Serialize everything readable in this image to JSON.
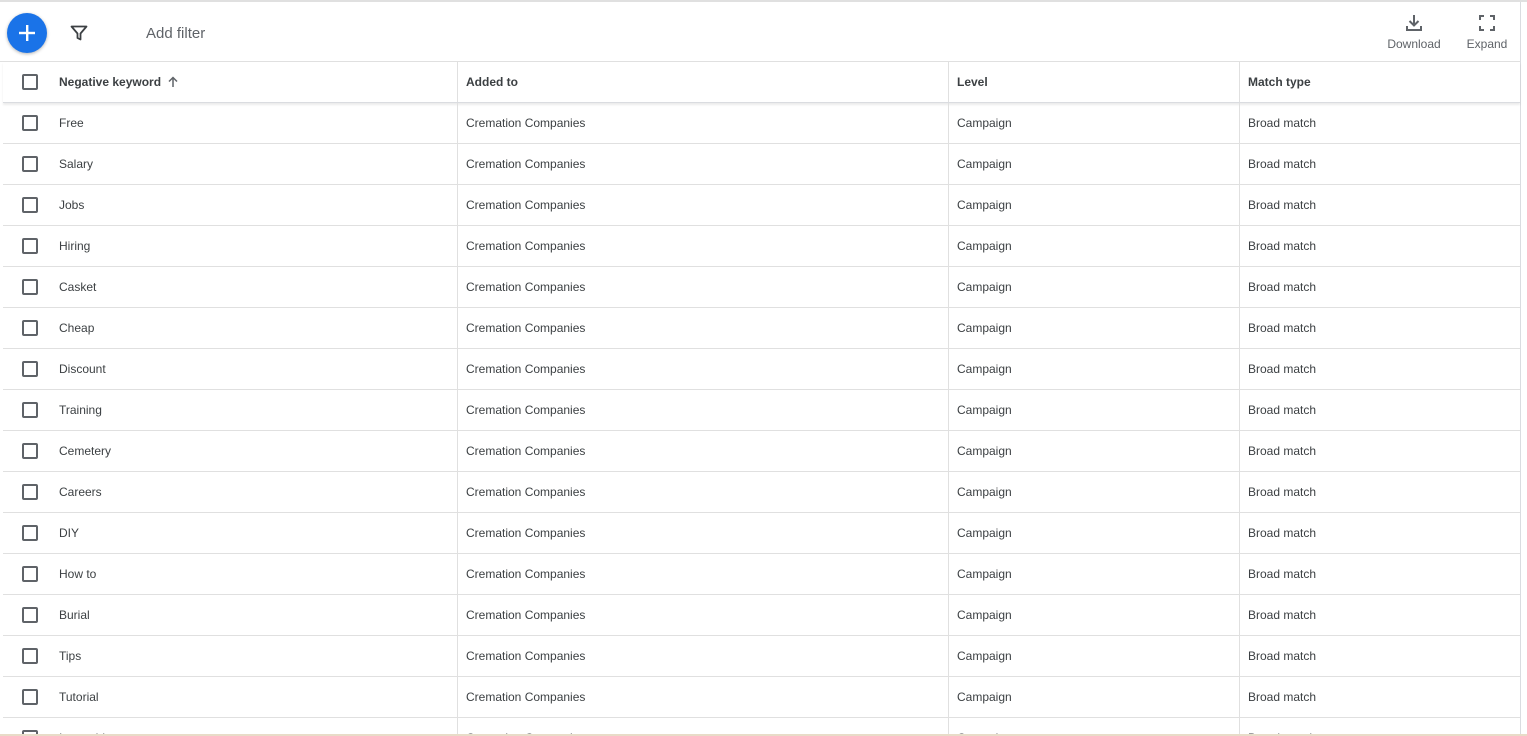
{
  "toolbar": {
    "add_filter_placeholder": "Add filter",
    "download_label": "Download",
    "expand_label": "Expand"
  },
  "colors": {
    "fab": "#1a73e8",
    "text": "#3c4043",
    "muted": "#5f6368",
    "divider": "#e0e0e0"
  },
  "table": {
    "columns": [
      "Negative keyword",
      "Added to",
      "Level",
      "Match type"
    ],
    "sort": {
      "column": "Negative keyword",
      "direction": "ascending"
    },
    "rows": [
      {
        "keyword": "Free",
        "added_to": "Cremation Companies",
        "level": "Campaign",
        "match_type": "Broad match"
      },
      {
        "keyword": "Salary",
        "added_to": "Cremation Companies",
        "level": "Campaign",
        "match_type": "Broad match"
      },
      {
        "keyword": "Jobs",
        "added_to": "Cremation Companies",
        "level": "Campaign",
        "match_type": "Broad match"
      },
      {
        "keyword": "Hiring",
        "added_to": "Cremation Companies",
        "level": "Campaign",
        "match_type": "Broad match"
      },
      {
        "keyword": "Casket",
        "added_to": "Cremation Companies",
        "level": "Campaign",
        "match_type": "Broad match"
      },
      {
        "keyword": "Cheap",
        "added_to": "Cremation Companies",
        "level": "Campaign",
        "match_type": "Broad match"
      },
      {
        "keyword": "Discount",
        "added_to": "Cremation Companies",
        "level": "Campaign",
        "match_type": "Broad match"
      },
      {
        "keyword": "Training",
        "added_to": "Cremation Companies",
        "level": "Campaign",
        "match_type": "Broad match"
      },
      {
        "keyword": "Cemetery",
        "added_to": "Cremation Companies",
        "level": "Campaign",
        "match_type": "Broad match"
      },
      {
        "keyword": "Careers",
        "added_to": "Cremation Companies",
        "level": "Campaign",
        "match_type": "Broad match"
      },
      {
        "keyword": "DIY",
        "added_to": "Cremation Companies",
        "level": "Campaign",
        "match_type": "Broad match"
      },
      {
        "keyword": "How to",
        "added_to": "Cremation Companies",
        "level": "Campaign",
        "match_type": "Broad match"
      },
      {
        "keyword": "Burial",
        "added_to": "Cremation Companies",
        "level": "Campaign",
        "match_type": "Broad match"
      },
      {
        "keyword": "Tips",
        "added_to": "Cremation Companies",
        "level": "Campaign",
        "match_type": "Broad match"
      },
      {
        "keyword": "Tutorial",
        "added_to": "Cremation Companies",
        "level": "Campaign",
        "match_type": "Broad match"
      },
      {
        "keyword": "Internship",
        "added_to": "Cremation Companies",
        "level": "Campaign",
        "match_type": "Broad match"
      }
    ]
  }
}
